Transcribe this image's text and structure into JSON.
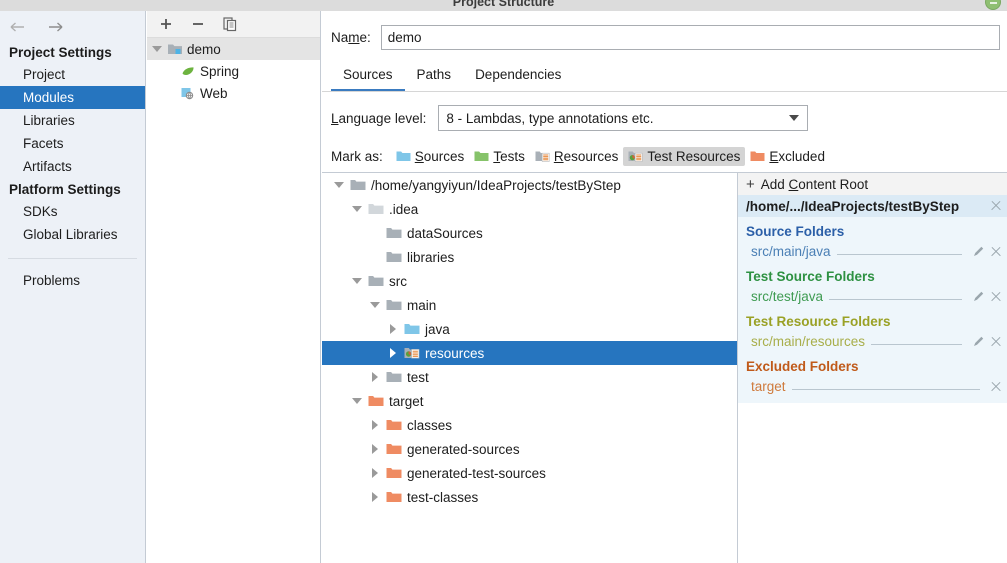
{
  "window": {
    "title": "Project Structure",
    "close_button": "close-window"
  },
  "sidebar": {
    "nav": {
      "back": "back-arrow",
      "forward": "forward-arrow"
    },
    "groups": [
      {
        "title": "Project Settings",
        "items": [
          {
            "label": "Project",
            "selected": false
          },
          {
            "label": "Modules",
            "selected": true
          },
          {
            "label": "Libraries",
            "selected": false
          },
          {
            "label": "Facets",
            "selected": false
          },
          {
            "label": "Artifacts",
            "selected": false
          }
        ]
      },
      {
        "title": "Platform Settings",
        "items": [
          {
            "label": "SDKs",
            "selected": false
          },
          {
            "label": "Global Libraries",
            "selected": false
          }
        ]
      }
    ],
    "footer_item": {
      "label": "Problems"
    }
  },
  "modules_panel": {
    "toolbar": [
      {
        "name": "add-module-button",
        "glyph": "plus"
      },
      {
        "name": "remove-module-button",
        "glyph": "minus"
      },
      {
        "name": "copy-module-button",
        "glyph": "copy"
      }
    ],
    "tree": {
      "root": {
        "label": "demo",
        "selected": true,
        "expanded": true
      },
      "children": [
        {
          "label": "Spring",
          "icon": "spring-leaf-icon"
        },
        {
          "label": "Web",
          "icon": "web-globe-icon"
        }
      ]
    }
  },
  "main": {
    "name_field": {
      "label": "Name:",
      "label_mnemonic": "m",
      "value": "demo"
    },
    "tabs": [
      {
        "label": "Sources",
        "active": true
      },
      {
        "label": "Paths",
        "active": false
      },
      {
        "label": "Dependencies",
        "active": false
      }
    ],
    "language_level": {
      "label": "Language level:",
      "label_mnemonic": "L",
      "value": "8 - Lambdas, type annotations etc."
    },
    "mark_as": {
      "label": "Mark as:",
      "buttons": [
        {
          "label": "Sources",
          "mnemonic": "S",
          "icon": "folder-sources-icon",
          "color": "#7fc6e8",
          "pressed": false
        },
        {
          "label": "Tests",
          "mnemonic": "T",
          "icon": "folder-tests-icon",
          "color": "#86c36a",
          "pressed": false
        },
        {
          "label": "Resources",
          "mnemonic": "R",
          "icon": "folder-resources-icon",
          "color": "#a9b0b6",
          "pressed": false
        },
        {
          "label": "Test Resources",
          "mnemonic": "",
          "icon": "folder-test-resources-icon",
          "color": "#a9b0b6",
          "pressed": true
        },
        {
          "label": "Excluded",
          "mnemonic": "E",
          "icon": "folder-excluded-icon",
          "color": "#ef8b62",
          "pressed": false
        }
      ]
    }
  },
  "content_tree": [
    {
      "label": "/home/yangyiyun/IdeaProjects/testByStep",
      "indent": 0,
      "toggle": "down",
      "icon": "folder-grey-icon",
      "selected": false
    },
    {
      "label": ".idea",
      "indent": 1,
      "toggle": "down",
      "icon": "folder-light-grey-icon",
      "selected": false
    },
    {
      "label": "dataSources",
      "indent": 2,
      "toggle": "none",
      "icon": "folder-grey-icon",
      "selected": false
    },
    {
      "label": "libraries",
      "indent": 2,
      "toggle": "none",
      "icon": "folder-grey-icon",
      "selected": false
    },
    {
      "label": "src",
      "indent": 1,
      "toggle": "down",
      "icon": "folder-grey-icon",
      "selected": false
    },
    {
      "label": "main",
      "indent": 2,
      "toggle": "down",
      "icon": "folder-grey-icon",
      "selected": false
    },
    {
      "label": "java",
      "indent": 3,
      "toggle": "right",
      "icon": "folder-sources-icon",
      "selected": false
    },
    {
      "label": "resources",
      "indent": 3,
      "toggle": "right",
      "icon": "folder-test-resources-icon",
      "selected": true
    },
    {
      "label": "test",
      "indent": 2,
      "toggle": "right",
      "icon": "folder-grey-icon",
      "selected": false
    },
    {
      "label": "target",
      "indent": 1,
      "toggle": "down",
      "icon": "folder-excluded-icon",
      "selected": false
    },
    {
      "label": "classes",
      "indent": 2,
      "toggle": "right",
      "icon": "folder-excluded-icon",
      "selected": false
    },
    {
      "label": "generated-sources",
      "indent": 2,
      "toggle": "right",
      "icon": "folder-excluded-icon",
      "selected": false
    },
    {
      "label": "generated-test-sources",
      "indent": 2,
      "toggle": "right",
      "icon": "folder-excluded-icon",
      "selected": false
    },
    {
      "label": "test-classes",
      "indent": 2,
      "toggle": "right",
      "icon": "folder-excluded-icon",
      "selected": false
    }
  ],
  "details": {
    "add_content_root": {
      "label": "Add Content Root",
      "mnemonic": "C"
    },
    "content_root": {
      "path": "/home/.../IdeaProjects/testByStep"
    },
    "groups": [
      {
        "title": "Source Folders",
        "color": "#2b5fa8",
        "entries": [
          {
            "path": "src/main/java",
            "editable": true
          }
        ]
      },
      {
        "title": "Test Source Folders",
        "color": "#2e9142",
        "entries": [
          {
            "path": "src/test/java",
            "editable": true
          }
        ]
      },
      {
        "title": "Test Resource Folders",
        "color": "#9aa125",
        "entries": [
          {
            "path": "src/main/resources",
            "editable": true
          }
        ]
      },
      {
        "title": "Excluded Folders",
        "color": "#c05a1a",
        "entries": [
          {
            "path": "target",
            "editable": false
          }
        ]
      }
    ]
  },
  "colors": {
    "selection_blue": "#2675bf",
    "panel_blue": "#eef6fb",
    "root_header_blue": "#dbeaf5",
    "sidebar_bg": "#edf1f7"
  }
}
